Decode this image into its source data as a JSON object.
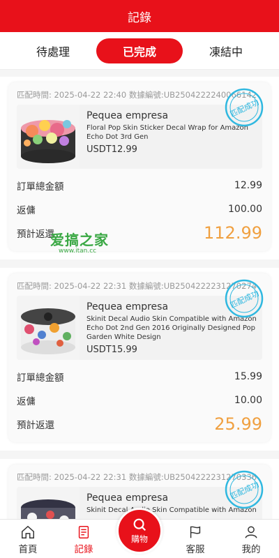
{
  "header": {
    "title": "記錄"
  },
  "tabs": [
    {
      "label": "待處理"
    },
    {
      "label": "已完成"
    },
    {
      "label": "凍結中"
    }
  ],
  "orders": [
    {
      "match_time_label": "匹配時間:",
      "match_time": "2025-04-22 22:40",
      "order_no_label": "数據編號:",
      "order_no": "UB2504222240066142",
      "stamp": "匹配成功",
      "store": "Pequea empresa",
      "title": "Floral Pop Skin Sticker Decal Wrap for Amazon Echo Dot 3rd Gen",
      "price": "USDT12.99",
      "total_label": "訂單總金額",
      "total": "12.99",
      "commission_label": "返傭",
      "commission": "100.00",
      "expected_label": "預計返還",
      "expected": "112.99"
    },
    {
      "match_time_label": "匹配時間:",
      "match_time": "2025-04-22 22:31",
      "order_no_label": "数據編號:",
      "order_no": "UB2504222231270274",
      "stamp": "匹配成功",
      "store": "Pequea empresa",
      "title": "Skinit Decal Audio Skin Compatible with Amazon Echo Dot 2nd Gen 2016 Originally Designed Pop Garden White Design",
      "price": "USDT15.99",
      "total_label": "訂單總金額",
      "total": "15.99",
      "commission_label": "返傭",
      "commission": "10.00",
      "expected_label": "預計返還",
      "expected": "25.99"
    },
    {
      "match_time_label": "匹配時間:",
      "match_time": "2025-04-22 22:31",
      "order_no_label": "数據編號:",
      "order_no": "UB2504222231270336",
      "stamp": "匹配成功",
      "store": "Pequea empresa",
      "title": "Skinit Decal Audio Skin Compatible with Amazon"
    }
  ],
  "watermark": {
    "logo": "爱搞之家",
    "url": "www.itan.cc"
  },
  "nav": [
    {
      "label": "首頁",
      "icon": "home-icon"
    },
    {
      "label": "記錄",
      "icon": "record-icon"
    },
    {
      "label": "購物",
      "icon": "search-icon"
    },
    {
      "label": "客服",
      "icon": "flag-icon"
    },
    {
      "label": "我的",
      "icon": "user-icon"
    }
  ],
  "colors": {
    "brand": "#e8111a",
    "expected": "#f0a040",
    "stamp": "#2fb8e0"
  }
}
